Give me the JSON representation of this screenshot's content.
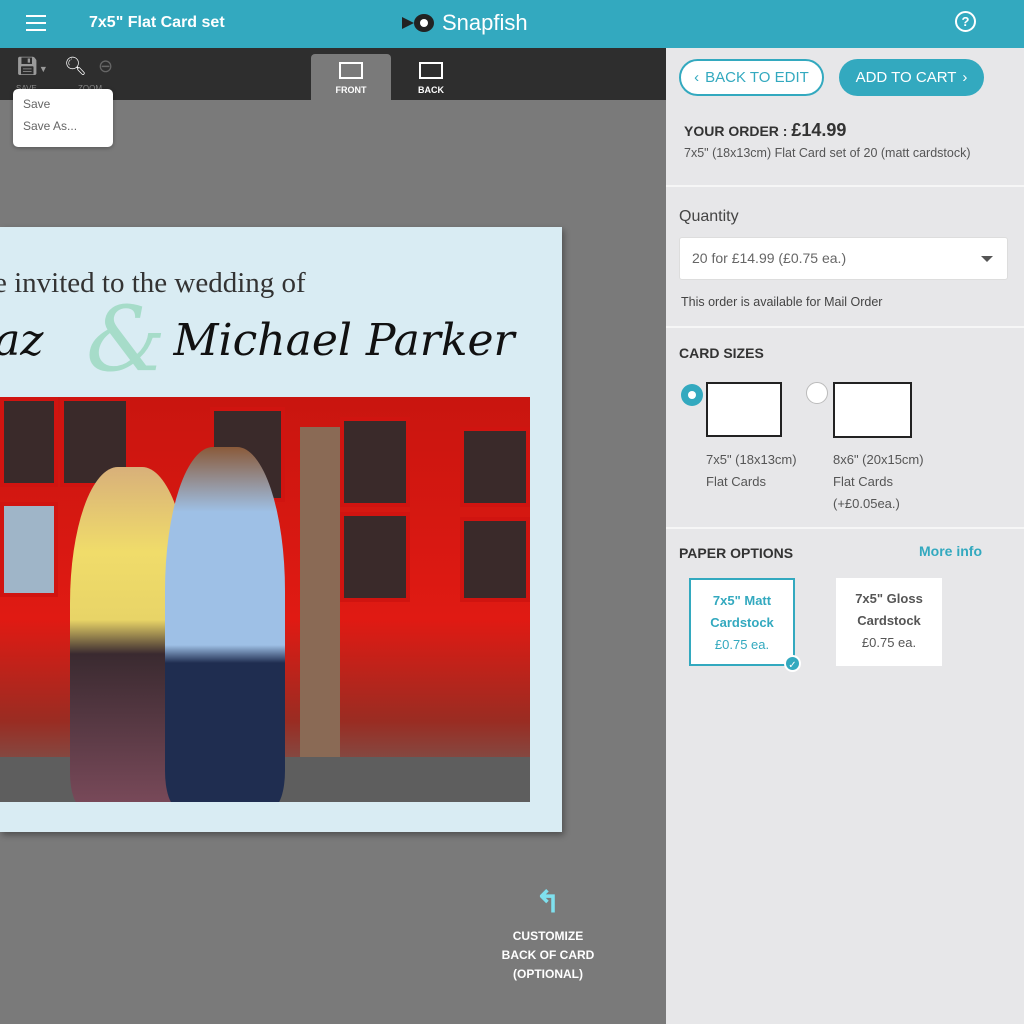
{
  "header": {
    "title": "7x5\" Flat Card set",
    "brand": "Snapfish",
    "help": "?"
  },
  "toolbar": {
    "save_label": "SAVE",
    "zoom_label": "ZOOM",
    "tabs": [
      {
        "label": "FRONT",
        "active": true
      },
      {
        "label": "BACK",
        "active": false
      }
    ]
  },
  "save_menu": {
    "items": [
      "Save",
      "Save As..."
    ]
  },
  "card": {
    "line1": "e invited to the wedding of",
    "name_left": "iaz",
    "ampersand": "&",
    "name_right": "Michael Parker"
  },
  "customize": {
    "line1": "CUSTOMIZE",
    "line2": "BACK OF CARD",
    "line3": "(OPTIONAL)"
  },
  "panel": {
    "back_label": "BACK TO EDIT",
    "add_label": "ADD TO CART",
    "order_label": "YOUR ORDER : ",
    "order_total": "£14.99",
    "order_desc": "7x5\" (18x13cm) Flat Card set of 20 (matt cardstock)",
    "quantity_label": "Quantity",
    "quantity_value": "20 for £14.99 (£0.75 ea.)",
    "mail_note": "This order is available for Mail Order",
    "card_sizes_title": "CARD SIZES",
    "sizes": [
      {
        "line1": "7x5\" (18x13cm)",
        "line2": "Flat Cards",
        "line3": "",
        "selected": true
      },
      {
        "line1": "8x6\" (20x15cm)",
        "line2": "Flat Cards",
        "line3": "(+£0.05ea.)",
        "selected": false
      }
    ],
    "paper_title": "PAPER OPTIONS",
    "more_info": "More info",
    "papers": [
      {
        "line1": "7x5\" Matt",
        "line2": "Cardstock",
        "price": "£0.75 ea.",
        "selected": true
      },
      {
        "line1": "7x5\" Gloss",
        "line2": "Cardstock",
        "price": "£0.75 ea.",
        "selected": false
      }
    ]
  },
  "colors": {
    "accent": "#33a9bf",
    "toolbar": "#2e2e2e",
    "canvas": "#7a7a7a",
    "panel": "#e7e7e9"
  }
}
